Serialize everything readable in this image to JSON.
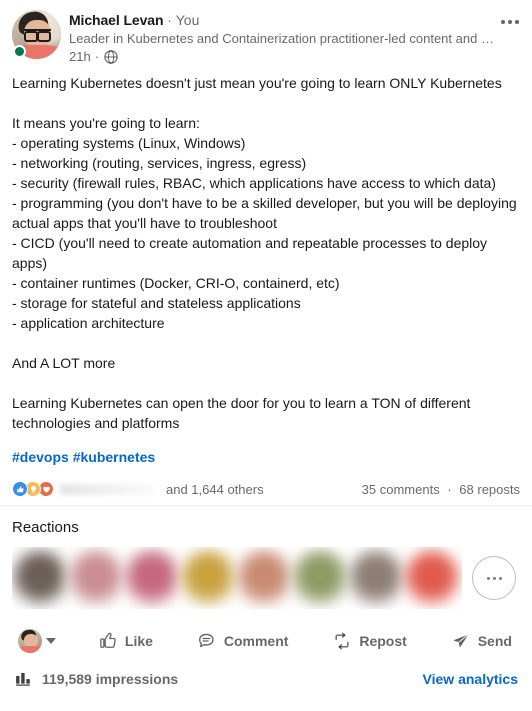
{
  "post": {
    "author": {
      "name": "Michael Levan",
      "separator": "·",
      "relationship": "You",
      "headline": "Leader in Kubernetes and Containerization practitioner-led content and …",
      "time_ago": "21h",
      "visibility_icon": "globe-icon",
      "status_indicator": "online-green-dot",
      "avatar_icon": "author-avatar-photo"
    },
    "menu": {
      "icon": "ellipsis-icon",
      "label": "More options"
    },
    "content": "Learning Kubernetes doesn't just mean you're going to learn ONLY Kubernetes\n\nIt means you're going to learn:\n- operating systems (Linux, Windows)\n- networking (routing, services, ingress, egress)\n- security (firewall rules, RBAC, which applications have access to which data)\n- programming (you don't have to be a skilled developer, but you will be deploying actual apps that you'll have to troubleshoot\n- CICD (you'll need to create automation and repeatable processes to deploy apps)\n- container runtimes (Docker, CRI-O, containerd, etc)\n- storage for stateful and stateless applications\n- application architecture\n\nAnd A LOT more\n\nLearning Kubernetes can open the door for you to learn a TON of different technologies and platforms",
    "hashtags": [
      "#devops",
      "#kubernetes"
    ],
    "social_counts": {
      "reaction_types": [
        "like-icon",
        "insightful-icon",
        "love-icon"
      ],
      "reactor_names_blurred": true,
      "others_text": "and 1,644 others",
      "comments_text": "35 comments",
      "counts_separator": "·",
      "reposts_text": "68 reposts"
    },
    "reactions_section": {
      "title": "Reactions",
      "more_button_icon": "ellipsis-icon",
      "faces": [
        {
          "name": "reactor-avatar-1",
          "color": "#6b5f57"
        },
        {
          "name": "reactor-avatar-2",
          "color": "#c98d92"
        },
        {
          "name": "reactor-avatar-3",
          "color": "#c4687f"
        },
        {
          "name": "reactor-avatar-4",
          "color": "#c9a23f"
        },
        {
          "name": "reactor-avatar-5",
          "color": "#c98b72"
        },
        {
          "name": "reactor-avatar-6",
          "color": "#8f9a64"
        },
        {
          "name": "reactor-avatar-7",
          "color": "#8d7d74"
        },
        {
          "name": "reactor-avatar-8",
          "color": "#e05a4e"
        }
      ]
    },
    "actions": [
      {
        "name": "like-button",
        "label": "Like",
        "icon": "thumbs-up-icon"
      },
      {
        "name": "comment-button",
        "label": "Comment",
        "icon": "comment-bubble-icon"
      },
      {
        "name": "repost-button",
        "label": "Repost",
        "icon": "repost-arrows-icon"
      },
      {
        "name": "send-button",
        "label": "Send",
        "icon": "paper-plane-icon"
      }
    ],
    "react_as": {
      "icon": "user-avatar-small",
      "caret_icon": "chevron-down-icon"
    },
    "analytics": {
      "icon": "bar-chart-icon",
      "impressions_text": "119,589 impressions",
      "view_analytics_label": "View analytics"
    }
  },
  "colors": {
    "link": "#0a66c2",
    "online": "#01754f",
    "like": "#378fe9",
    "insightful": "#f5bb5c",
    "love": "#df704d"
  }
}
